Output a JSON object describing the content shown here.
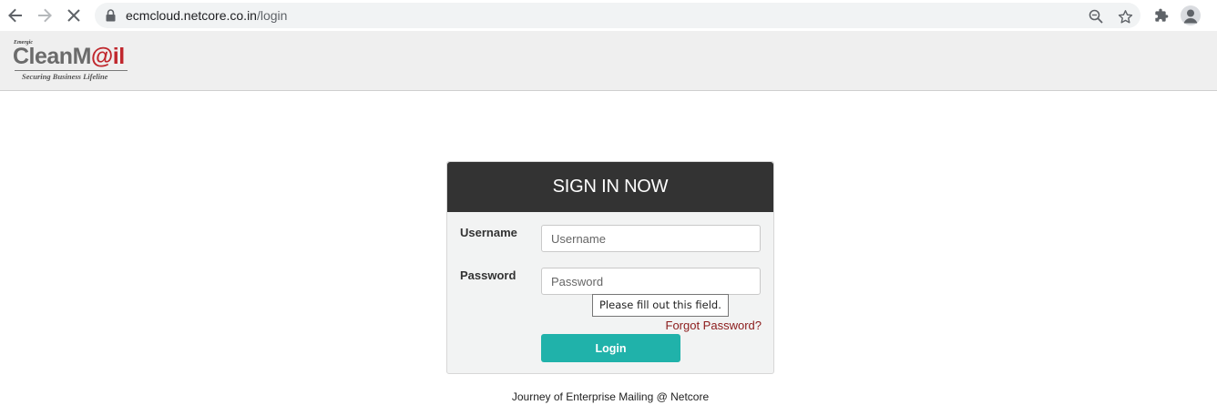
{
  "browser": {
    "url_host": "ecmcloud.netcore.co.in",
    "url_path": "/login",
    "icons": [
      "back-arrow-icon",
      "forward-arrow-icon",
      "stop-loading-icon",
      "lock-icon",
      "zoom-icon",
      "bookmark-star-icon",
      "extensions-puzzle-icon",
      "profile-avatar-icon"
    ]
  },
  "header": {
    "logo_small": "Emergic",
    "logo_text_1": "CleanM",
    "logo_text_accent": "@il",
    "logo_tagline": "Securing  Business  Lifeline"
  },
  "login": {
    "title": "SIGN IN NOW",
    "username_label": "Username",
    "username_placeholder": "Username",
    "username_value": "",
    "password_label": "Password",
    "password_placeholder": "Password",
    "password_value": "",
    "validation_tooltip": "Please fill out this field.",
    "forgot_link": "Forgot Password?",
    "login_button": "Login"
  },
  "footer": {
    "text": "Journey of Enterprise Mailing @ Netcore"
  },
  "colors": {
    "header_dark": "#333333",
    "button_teal": "#20b2aa",
    "link_red": "#8b1a1a",
    "logo_red": "#c0272d"
  }
}
